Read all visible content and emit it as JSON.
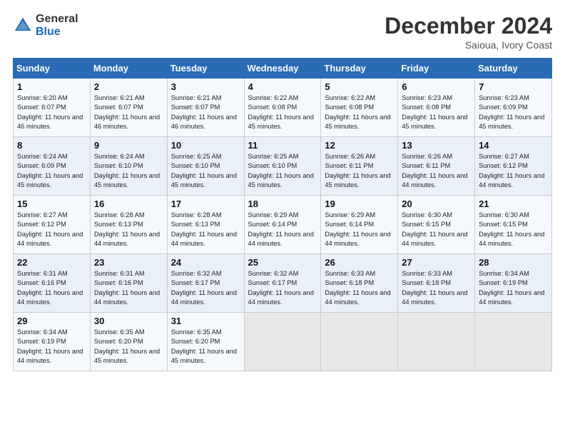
{
  "header": {
    "logo_general": "General",
    "logo_blue": "Blue",
    "month_title": "December 2024",
    "location": "Saioua, Ivory Coast"
  },
  "days_of_week": [
    "Sunday",
    "Monday",
    "Tuesday",
    "Wednesday",
    "Thursday",
    "Friday",
    "Saturday"
  ],
  "weeks": [
    [
      {
        "day": "1",
        "sunrise": "6:20 AM",
        "sunset": "6:07 PM",
        "daylight": "11 hours and 46 minutes."
      },
      {
        "day": "2",
        "sunrise": "6:21 AM",
        "sunset": "6:07 PM",
        "daylight": "11 hours and 46 minutes."
      },
      {
        "day": "3",
        "sunrise": "6:21 AM",
        "sunset": "6:07 PM",
        "daylight": "11 hours and 46 minutes."
      },
      {
        "day": "4",
        "sunrise": "6:22 AM",
        "sunset": "6:08 PM",
        "daylight": "11 hours and 45 minutes."
      },
      {
        "day": "5",
        "sunrise": "6:22 AM",
        "sunset": "6:08 PM",
        "daylight": "11 hours and 45 minutes."
      },
      {
        "day": "6",
        "sunrise": "6:23 AM",
        "sunset": "6:08 PM",
        "daylight": "11 hours and 45 minutes."
      },
      {
        "day": "7",
        "sunrise": "6:23 AM",
        "sunset": "6:09 PM",
        "daylight": "11 hours and 45 minutes."
      }
    ],
    [
      {
        "day": "8",
        "sunrise": "6:24 AM",
        "sunset": "6:09 PM",
        "daylight": "11 hours and 45 minutes."
      },
      {
        "day": "9",
        "sunrise": "6:24 AM",
        "sunset": "6:10 PM",
        "daylight": "11 hours and 45 minutes."
      },
      {
        "day": "10",
        "sunrise": "6:25 AM",
        "sunset": "6:10 PM",
        "daylight": "11 hours and 45 minutes."
      },
      {
        "day": "11",
        "sunrise": "6:25 AM",
        "sunset": "6:10 PM",
        "daylight": "11 hours and 45 minutes."
      },
      {
        "day": "12",
        "sunrise": "6:26 AM",
        "sunset": "6:11 PM",
        "daylight": "11 hours and 45 minutes."
      },
      {
        "day": "13",
        "sunrise": "6:26 AM",
        "sunset": "6:11 PM",
        "daylight": "11 hours and 44 minutes."
      },
      {
        "day": "14",
        "sunrise": "6:27 AM",
        "sunset": "6:12 PM",
        "daylight": "11 hours and 44 minutes."
      }
    ],
    [
      {
        "day": "15",
        "sunrise": "6:27 AM",
        "sunset": "6:12 PM",
        "daylight": "11 hours and 44 minutes."
      },
      {
        "day": "16",
        "sunrise": "6:28 AM",
        "sunset": "6:13 PM",
        "daylight": "11 hours and 44 minutes."
      },
      {
        "day": "17",
        "sunrise": "6:28 AM",
        "sunset": "6:13 PM",
        "daylight": "11 hours and 44 minutes."
      },
      {
        "day": "18",
        "sunrise": "6:29 AM",
        "sunset": "6:14 PM",
        "daylight": "11 hours and 44 minutes."
      },
      {
        "day": "19",
        "sunrise": "6:29 AM",
        "sunset": "6:14 PM",
        "daylight": "11 hours and 44 minutes."
      },
      {
        "day": "20",
        "sunrise": "6:30 AM",
        "sunset": "6:15 PM",
        "daylight": "11 hours and 44 minutes."
      },
      {
        "day": "21",
        "sunrise": "6:30 AM",
        "sunset": "6:15 PM",
        "daylight": "11 hours and 44 minutes."
      }
    ],
    [
      {
        "day": "22",
        "sunrise": "6:31 AM",
        "sunset": "6:16 PM",
        "daylight": "11 hours and 44 minutes."
      },
      {
        "day": "23",
        "sunrise": "6:31 AM",
        "sunset": "6:16 PM",
        "daylight": "11 hours and 44 minutes."
      },
      {
        "day": "24",
        "sunrise": "6:32 AM",
        "sunset": "6:17 PM",
        "daylight": "11 hours and 44 minutes."
      },
      {
        "day": "25",
        "sunrise": "6:32 AM",
        "sunset": "6:17 PM",
        "daylight": "11 hours and 44 minutes."
      },
      {
        "day": "26",
        "sunrise": "6:33 AM",
        "sunset": "6:18 PM",
        "daylight": "11 hours and 44 minutes."
      },
      {
        "day": "27",
        "sunrise": "6:33 AM",
        "sunset": "6:18 PM",
        "daylight": "11 hours and 44 minutes."
      },
      {
        "day": "28",
        "sunrise": "6:34 AM",
        "sunset": "6:19 PM",
        "daylight": "11 hours and 44 minutes."
      }
    ],
    [
      {
        "day": "29",
        "sunrise": "6:34 AM",
        "sunset": "6:19 PM",
        "daylight": "11 hours and 44 minutes."
      },
      {
        "day": "30",
        "sunrise": "6:35 AM",
        "sunset": "6:20 PM",
        "daylight": "11 hours and 45 minutes."
      },
      {
        "day": "31",
        "sunrise": "6:35 AM",
        "sunset": "6:20 PM",
        "daylight": "11 hours and 45 minutes."
      },
      null,
      null,
      null,
      null
    ]
  ]
}
